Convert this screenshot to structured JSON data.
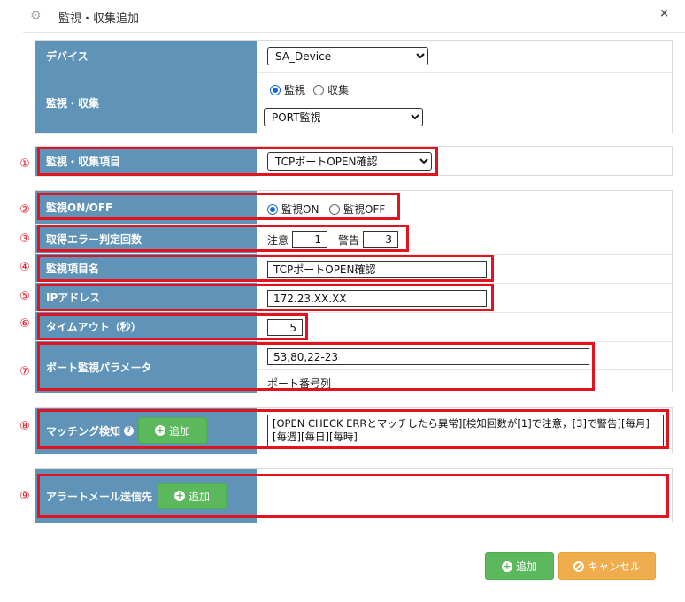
{
  "dialog": {
    "title": "監視・収集追加",
    "close_label": "×"
  },
  "device": {
    "label": "デバイス",
    "selected": "SA_Device"
  },
  "monitor_collect": {
    "label": "監視・収集",
    "radio_monitor": "監視",
    "radio_collect": "収集",
    "selected_type": "PORT監視"
  },
  "markers": [
    "①",
    "②",
    "③",
    "④",
    "⑤",
    "⑥",
    "⑦",
    "⑧",
    "⑨"
  ],
  "item": {
    "label": "監視・収集項目",
    "selected": "TCPポートOPEN確認"
  },
  "onoff": {
    "label": "監視ON/OFF",
    "on_label": "監視ON",
    "off_label": "監視OFF"
  },
  "error_count": {
    "label": "取得エラー判定回数",
    "warn_label": "注意",
    "warn_value": "1",
    "alert_label": "警告",
    "alert_value": "3"
  },
  "item_name": {
    "label": "監視項目名",
    "value": "TCPポートOPEN確認"
  },
  "ip": {
    "label": "IPアドレス",
    "value": "172.23.XX.XX"
  },
  "timeout": {
    "label": "タイムアウト（秒）",
    "value": "5"
  },
  "port_param": {
    "label": "ポート監視パラメータ",
    "value": "53,80,22-23",
    "hint": "ポート番号列"
  },
  "matching": {
    "label": "マッチング検知",
    "add_label": "追加",
    "text": "[OPEN CHECK ERRとマッチしたら異常][検知回数が[1]で注意，[3]で警告][毎月][毎週][毎日][毎時]"
  },
  "alert_mail": {
    "label": "アラートメール送信先",
    "add_label": "追加"
  },
  "footer": {
    "add_label": "追加",
    "cancel_label": "キャンセル"
  }
}
